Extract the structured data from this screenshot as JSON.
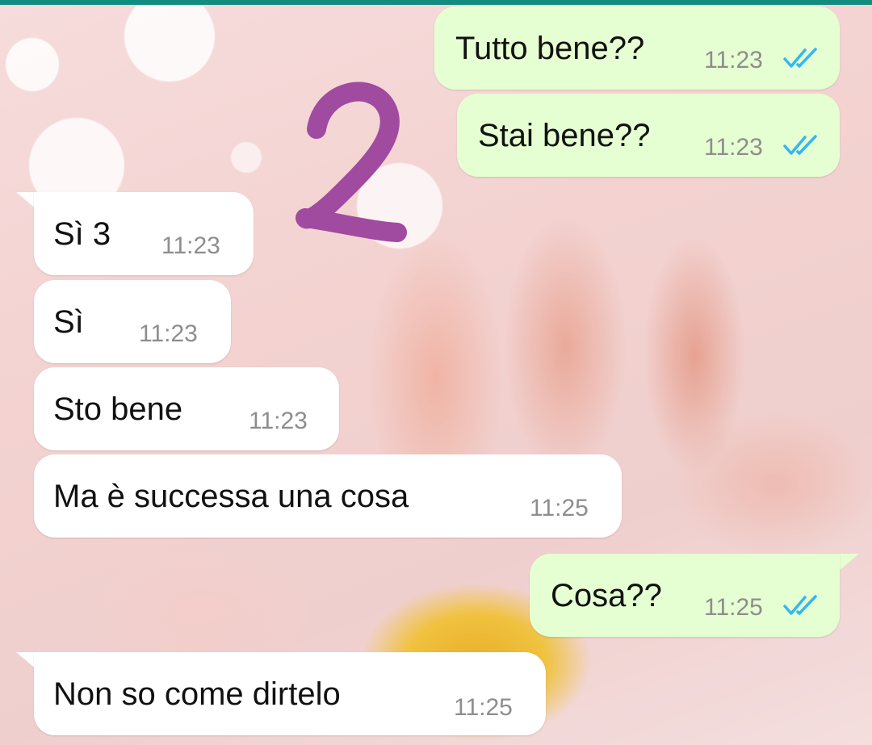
{
  "chat": {
    "annotation": "2",
    "check_color": "#34b7f1",
    "messages": [
      {
        "direction": "outgoing",
        "text": "Tutto bene??",
        "time": "11:23",
        "status": "read"
      },
      {
        "direction": "outgoing",
        "text": "Stai bene??",
        "time": "11:23",
        "status": "read"
      },
      {
        "direction": "incoming",
        "text": "Sì 3",
        "time": "11:23"
      },
      {
        "direction": "incoming",
        "text": "Sì",
        "time": "11:23"
      },
      {
        "direction": "incoming",
        "text": "Sto bene",
        "time": "11:23"
      },
      {
        "direction": "incoming",
        "text": "Ma è successa una cosa",
        "time": "11:25"
      },
      {
        "direction": "outgoing",
        "text": "Cosa??",
        "time": "11:25",
        "status": "read"
      },
      {
        "direction": "incoming",
        "text": "Non so come dirtelo",
        "time": "11:25"
      }
    ]
  }
}
